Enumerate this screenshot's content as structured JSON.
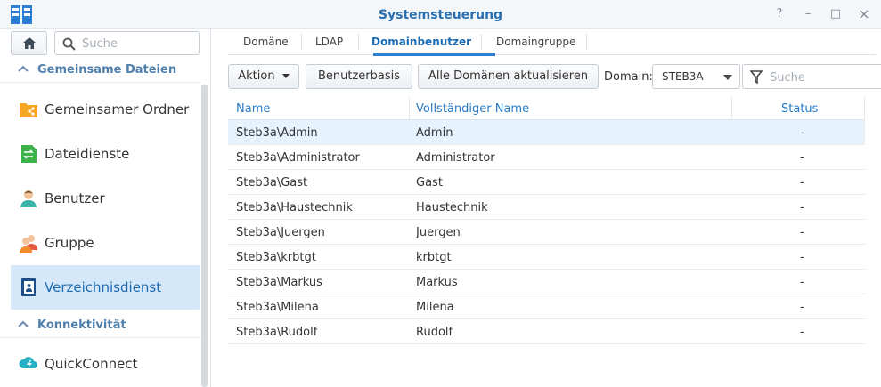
{
  "window": {
    "title": "Systemsteuerung",
    "controls": {
      "help": "?",
      "minimize": "–",
      "maximize": "□",
      "close": "×"
    }
  },
  "sidebar": {
    "search_placeholder": "Suche",
    "sections": [
      {
        "label": "Gemeinsame Dateien"
      },
      {
        "label": "Konnektivität"
      }
    ],
    "items": [
      {
        "label": "Gemeinsamer Ordner",
        "icon": "shared-folder-icon"
      },
      {
        "label": "Dateidienste",
        "icon": "file-services-icon"
      },
      {
        "label": "Benutzer",
        "icon": "user-icon"
      },
      {
        "label": "Gruppe",
        "icon": "group-icon"
      },
      {
        "label": "Verzeichnisdienst",
        "icon": "directory-service-icon",
        "active": true
      },
      {
        "label": "QuickConnect",
        "icon": "quickconnect-icon"
      }
    ]
  },
  "tabs": [
    {
      "label": "Domäne"
    },
    {
      "label": "LDAP"
    },
    {
      "label": "Domainbenutzer",
      "active": true
    },
    {
      "label": "Domaingruppe"
    }
  ],
  "toolbar": {
    "action_label": "Aktion",
    "base_label": "Benutzerbasis",
    "refresh_label": "Alle Domänen aktualisieren",
    "domain_label": "Domain:",
    "domain_value": "STEB3A",
    "filter_placeholder": "Suche"
  },
  "table": {
    "columns": [
      "Name",
      "Vollständiger Name",
      "Status"
    ],
    "rows": [
      {
        "name": "Steb3a\\Admin",
        "full": "Admin",
        "status": "-",
        "selected": true
      },
      {
        "name": "Steb3a\\Administrator",
        "full": "Administrator",
        "status": "-"
      },
      {
        "name": "Steb3a\\Gast",
        "full": "Gast",
        "status": "-"
      },
      {
        "name": "Steb3a\\Haustechnik",
        "full": "Haustechnik",
        "status": "-"
      },
      {
        "name": "Steb3a\\Juergen",
        "full": "Juergen",
        "status": "-"
      },
      {
        "name": "Steb3a\\krbtgt",
        "full": "krbtgt",
        "status": "-"
      },
      {
        "name": "Steb3a\\Markus",
        "full": "Markus",
        "status": "-"
      },
      {
        "name": "Steb3a\\Milena",
        "full": "Milena",
        "status": "-"
      },
      {
        "name": "Steb3a\\Rudolf",
        "full": "Rudolf",
        "status": "-"
      }
    ]
  },
  "colors": {
    "accent": "#2f7fd1",
    "title": "#2a6fb0",
    "active_bg": "#d4e8fa",
    "selected_row": "#e6f2fc"
  }
}
